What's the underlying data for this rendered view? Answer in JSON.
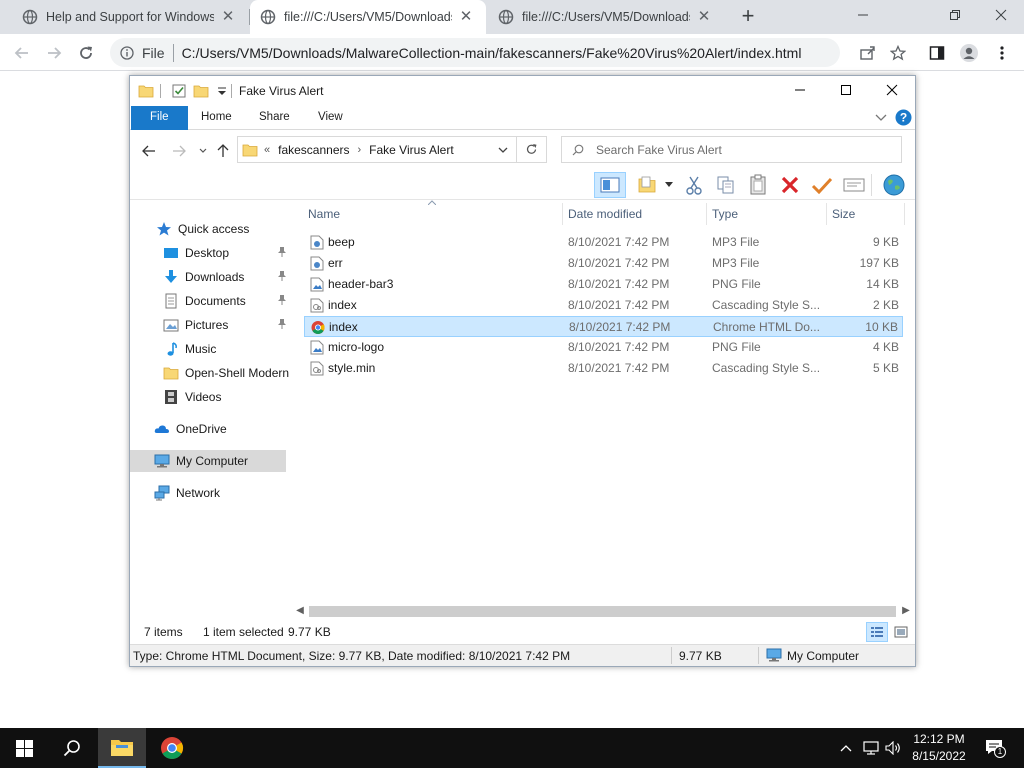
{
  "browser": {
    "tabs": [
      {
        "title": "Help and Support for Windows",
        "active": false
      },
      {
        "title": "file:///C:/Users/VM5/Downloads/",
        "active": true
      },
      {
        "title": "file:///C:/Users/VM5/Downloads/",
        "active": false
      }
    ],
    "omnibox": {
      "scheme_label": "File",
      "url": "C:/Users/VM5/Downloads/MalwareCollection-main/fakescanners/Fake%20Virus%20Alert/index.html"
    }
  },
  "explorer": {
    "title": "Fake Virus Alert",
    "ribbon_tabs": [
      "File",
      "Home",
      "Share",
      "View"
    ],
    "breadcrumb": {
      "overflow": "«",
      "items": [
        "fakescanners",
        "Fake Virus Alert"
      ]
    },
    "search_placeholder": "Search Fake Virus Alert",
    "nav_pane": {
      "quick_access": "Quick access",
      "quick_items": [
        {
          "label": "Desktop",
          "pinned": true
        },
        {
          "label": "Downloads",
          "pinned": true
        },
        {
          "label": "Documents",
          "pinned": true
        },
        {
          "label": "Pictures",
          "pinned": true
        },
        {
          "label": "Music",
          "pinned": false
        },
        {
          "label": "Open-Shell Modern",
          "pinned": false
        },
        {
          "label": "Videos",
          "pinned": false
        }
      ],
      "onedrive": "OneDrive",
      "my_computer": "My Computer",
      "network": "Network"
    },
    "columns": [
      "Name",
      "Date modified",
      "Type",
      "Size"
    ],
    "files": [
      {
        "name": "beep",
        "date": "8/10/2021 7:42 PM",
        "type": "MP3 File",
        "size": "9 KB",
        "icon": "audio-file-icon",
        "selected": false
      },
      {
        "name": "err",
        "date": "8/10/2021 7:42 PM",
        "type": "MP3 File",
        "size": "197 KB",
        "icon": "audio-file-icon",
        "selected": false
      },
      {
        "name": "header-bar3",
        "date": "8/10/2021 7:42 PM",
        "type": "PNG File",
        "size": "14 KB",
        "icon": "image-file-icon",
        "selected": false
      },
      {
        "name": "index",
        "date": "8/10/2021 7:42 PM",
        "type": "Cascading Style S...",
        "size": "2 KB",
        "icon": "css-file-icon",
        "selected": false
      },
      {
        "name": "index",
        "date": "8/10/2021 7:42 PM",
        "type": "Chrome HTML Do...",
        "size": "10 KB",
        "icon": "chrome-file-icon",
        "selected": true
      },
      {
        "name": "micro-logo",
        "date": "8/10/2021 7:42 PM",
        "type": "PNG File",
        "size": "4 KB",
        "icon": "image-file-icon",
        "selected": false
      },
      {
        "name": "style.min",
        "date": "8/10/2021 7:42 PM",
        "type": "Cascading Style S...",
        "size": "5 KB",
        "icon": "css-file-icon",
        "selected": false
      }
    ],
    "status": {
      "count": "7 items",
      "selection": "1 item selected",
      "size": "9.77 KB"
    },
    "details": {
      "text": "Type: Chrome HTML Document, Size: 9.77 KB, Date modified: 8/10/2021 7:42 PM",
      "size": "9.77 KB",
      "location": "My Computer"
    }
  },
  "taskbar": {
    "time": "12:12 PM",
    "date": "8/15/2022",
    "notification_count": "1"
  },
  "colors": {
    "accent": "#1979ca",
    "selection": "#cce8ff",
    "taskbar": "#101010"
  }
}
